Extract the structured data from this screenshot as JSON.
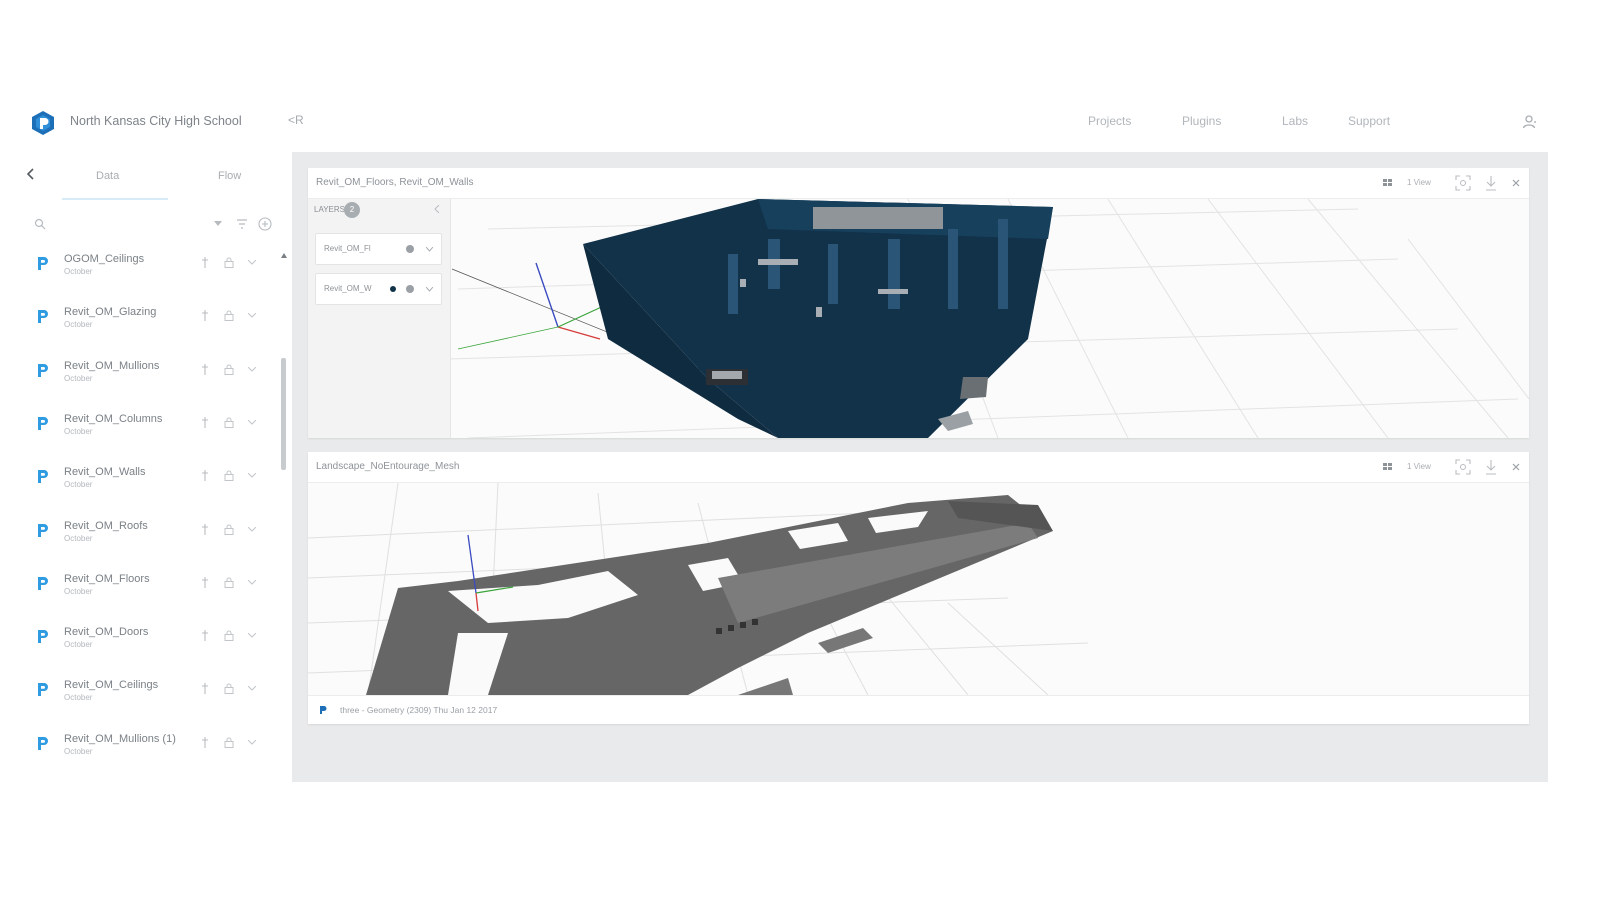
{
  "header": {
    "project_title": "North Kansas City High School",
    "collapse_label": "<R",
    "nav": [
      "Projects",
      "Plugins",
      "Labs",
      "Support"
    ],
    "brand_color": "#1d6fb8"
  },
  "sidebar": {
    "back_icon": "chevron-left-icon",
    "tabs": [
      {
        "label": "Data",
        "active": true
      },
      {
        "label": "Flow",
        "active": false
      }
    ],
    "streams": [
      {
        "name": "OGOM_Ceilings",
        "branch": "October"
      },
      {
        "name": "Revit_OM_Glazing",
        "branch": "October"
      },
      {
        "name": "Revit_OM_Mullions",
        "branch": "October"
      },
      {
        "name": "Revit_OM_Columns",
        "branch": "October"
      },
      {
        "name": "Revit_OM_Walls",
        "branch": "October"
      },
      {
        "name": "Revit_OM_Roofs",
        "branch": "October"
      },
      {
        "name": "Revit_OM_Floors",
        "branch": "October"
      },
      {
        "name": "Revit_OM_Doors",
        "branch": "October"
      },
      {
        "name": "Revit_OM_Ceilings",
        "branch": "October"
      },
      {
        "name": "Revit_OM_Mullions (1)",
        "branch": "October"
      }
    ]
  },
  "viewer_top": {
    "title": "Revit_OM_Floors, Revit_OM_Walls",
    "views_label": "1 View",
    "layers_label": "LAYERS",
    "layers_count": "2",
    "layers": [
      {
        "name": "Revit_OM_Fl"
      },
      {
        "name": "Revit_OM_W"
      }
    ],
    "model_color": "#12324a"
  },
  "viewer_bottom": {
    "title": "Landscape_NoEntourage_Mesh",
    "views_label": "1 View",
    "status": "three - Geometry (2309)  Thu Jan 12 2017",
    "model_color": "#6a6a6a"
  }
}
